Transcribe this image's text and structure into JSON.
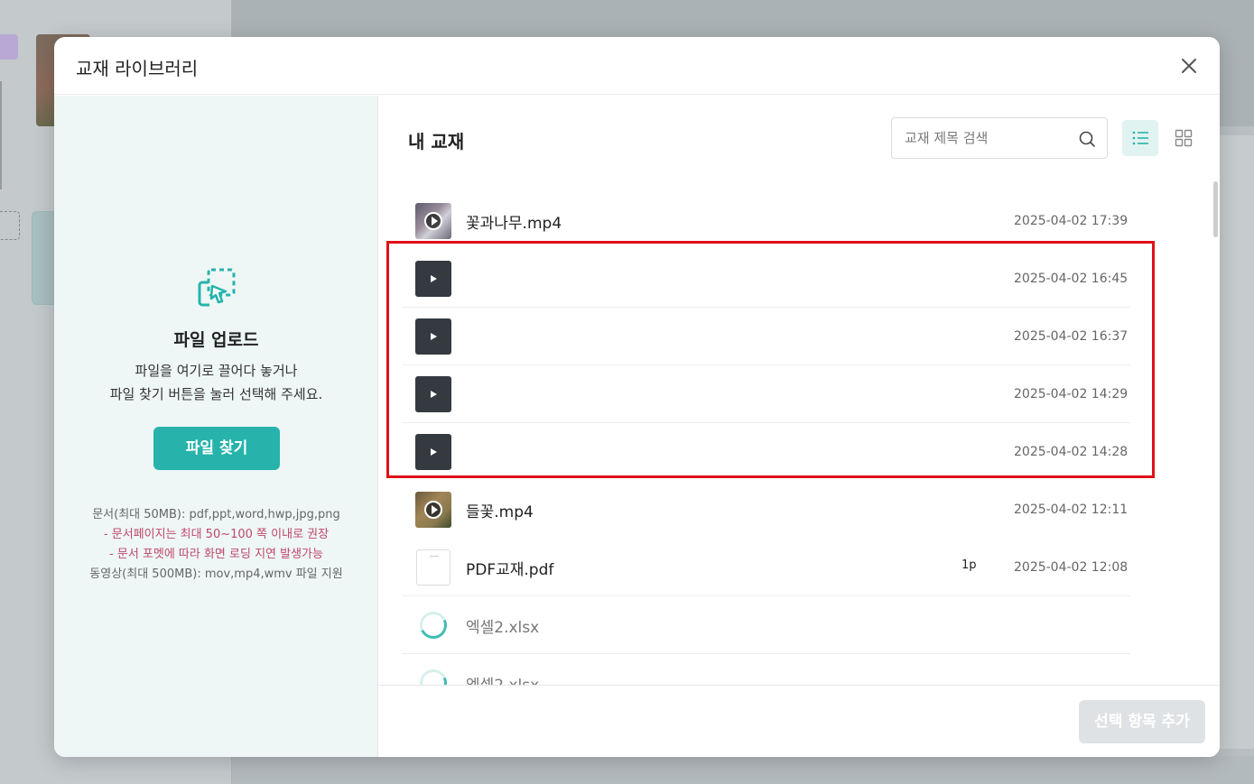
{
  "modal": {
    "title": "교재 라이브러리"
  },
  "upload": {
    "title": "파일 업로드",
    "desc_line1": "파일을 여기로 끌어다 놓거나",
    "desc_line2": "파일 찾기 버튼을 눌러 선택해 주세요.",
    "button": "파일 찾기",
    "info_doc": "문서(최대 50MB): pdf,ppt,word,hwp,jpg,png",
    "info_warn1": "- 문서페이지는 최대 50~100 쪽 이내로 권장",
    "info_warn2": "- 문서 포멧에 따라 화면 로딩 지연 발생가능",
    "info_video": "동영상(최대 500MB): mov,mp4,wmv 파일 지원"
  },
  "library": {
    "section_title": "내 교재",
    "search_placeholder": "교재 제목 검색",
    "files": [
      {
        "name": "꽃과나무.mp4",
        "date": "2025-04-02 17:39",
        "thumb": "video"
      },
      {
        "name": "",
        "date": "2025-04-02 16:45",
        "thumb": "play-icon"
      },
      {
        "name": "",
        "date": "2025-04-02 16:37",
        "thumb": "play-icon"
      },
      {
        "name": "",
        "date": "2025-04-02 14:29",
        "thumb": "play-icon"
      },
      {
        "name": "",
        "date": "2025-04-02 14:28",
        "thumb": "play-icon"
      },
      {
        "name": "들꽃.mp4",
        "date": "2025-04-02 12:11",
        "thumb": "video"
      },
      {
        "name": "PDF교재.pdf",
        "pages": "1p",
        "date": "2025-04-02 12:08",
        "thumb": "document"
      },
      {
        "name": "엑셀2.xlsx",
        "date": "",
        "thumb": "loading"
      },
      {
        "name": "엑셀2.xlsx",
        "date": "",
        "thumb": "loading"
      }
    ]
  },
  "footer": {
    "add_button": "선택 항목 추가"
  },
  "colors": {
    "accent": "#27b3ac",
    "highlight_border": "#e0101a",
    "warning_text": "#c0476a"
  }
}
